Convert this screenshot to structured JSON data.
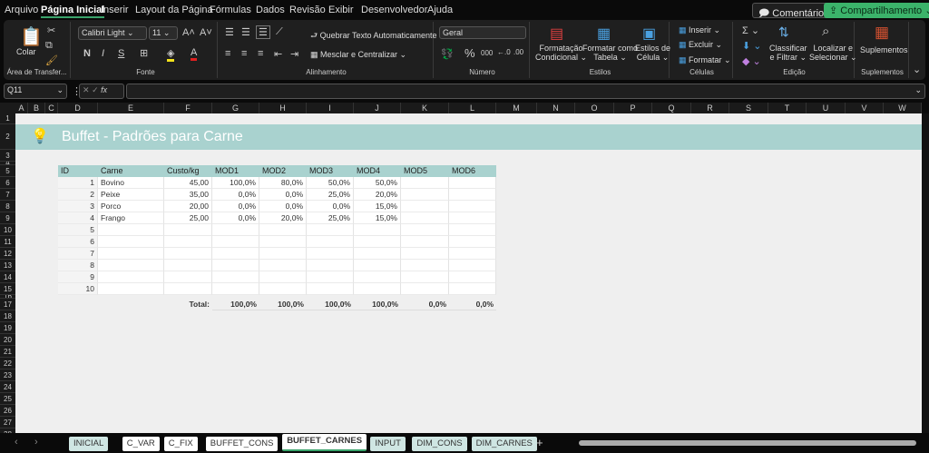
{
  "menu": [
    "Arquivo",
    "Página Inicial",
    "Inserir",
    "Layout da Página",
    "Fórmulas",
    "Dados",
    "Revisão",
    "Exibir",
    "Desenvolvedor",
    "Ajuda"
  ],
  "top_buttons": {
    "comments": "Comentários",
    "share": "Compartilhamento"
  },
  "colors": {
    "accent": "#3aa46b",
    "share": "#3bb36a",
    "table_header": "#a9d2cf"
  },
  "ribbon": {
    "clipboard": {
      "paste": "Colar",
      "label": "Área de Transfer..."
    },
    "font": {
      "name": "Calibri Light",
      "size": "11",
      "bold": "N",
      "italic": "I",
      "underline": "S",
      "label": "Fonte"
    },
    "alignment": {
      "wrap": "Quebrar Texto Automaticamente",
      "merge": "Mesclar e Centralizar",
      "label": "Alinhamento"
    },
    "number": {
      "format": "Geral",
      "label": "Número"
    },
    "styles": {
      "conditional": [
        "Formatação",
        "Condicional"
      ],
      "table": [
        "Formatar como",
        "Tabela"
      ],
      "cell": [
        "Estilos de",
        "Célula"
      ],
      "label": "Estilos"
    },
    "cells": {
      "insert": "Inserir",
      "delete": "Excluir",
      "format": "Formatar",
      "label": "Células"
    },
    "editing": {
      "sort": [
        "Classificar",
        "e Filtrar"
      ],
      "find": [
        "Localizar e",
        "Selecionar"
      ],
      "label": "Edição"
    },
    "addins": {
      "button": "Suplementos",
      "label": "Suplementos"
    }
  },
  "formula_bar": {
    "name_box": "Q11",
    "formula": ""
  },
  "columns": [
    "A",
    "B",
    "C",
    "D",
    "E",
    "F",
    "G",
    "H",
    "I",
    "J",
    "K",
    "L",
    "M",
    "N",
    "O",
    "P",
    "Q",
    "R",
    "S",
    "T",
    "U",
    "V",
    "W"
  ],
  "rows": [
    "1",
    "2",
    "3",
    "4",
    "5",
    "6",
    "7",
    "8",
    "9",
    "10",
    "11",
    "12",
    "13",
    "14",
    "15",
    "16",
    "17",
    "18",
    "19",
    "20",
    "21",
    "22",
    "23",
    "24",
    "25",
    "26",
    "27",
    "28"
  ],
  "sheet": {
    "title": "Buffet - Padrões para Carne",
    "headers": [
      "ID",
      "Carne",
      "Custo/kg",
      "MOD1",
      "MOD2",
      "MOD3",
      "MOD4",
      "MOD5",
      "MOD6"
    ],
    "data": [
      [
        "1",
        "Bovino",
        "45,00",
        "100,0%",
        "80,0%",
        "50,0%",
        "50,0%",
        "",
        ""
      ],
      [
        "2",
        "Peixe",
        "35,00",
        "0,0%",
        "0,0%",
        "25,0%",
        "20,0%",
        "",
        ""
      ],
      [
        "3",
        "Porco",
        "20,00",
        "0,0%",
        "0,0%",
        "0,0%",
        "15,0%",
        "",
        ""
      ],
      [
        "4",
        "Frango",
        "25,00",
        "0,0%",
        "20,0%",
        "25,0%",
        "15,0%",
        "",
        ""
      ],
      [
        "5",
        "",
        "",
        "",
        "",
        "",
        "",
        "",
        ""
      ],
      [
        "6",
        "",
        "",
        "",
        "",
        "",
        "",
        "",
        ""
      ],
      [
        "7",
        "",
        "",
        "",
        "",
        "",
        "",
        "",
        ""
      ],
      [
        "8",
        "",
        "",
        "",
        "",
        "",
        "",
        "",
        ""
      ],
      [
        "9",
        "",
        "",
        "",
        "",
        "",
        "",
        "",
        ""
      ],
      [
        "10",
        "",
        "",
        "",
        "",
        "",
        "",
        "",
        ""
      ]
    ],
    "total_label": "Total:",
    "totals": [
      "100,0%",
      "100,0%",
      "100,0%",
      "100,0%",
      "0,0%",
      "0,0%"
    ]
  },
  "tabs": [
    {
      "name": "INICIAL",
      "color": "#cfe6e3"
    },
    {
      "name": "C_VAR",
      "color": "#ffffff"
    },
    {
      "name": "C_FIX",
      "color": "#ffffff"
    },
    {
      "name": "BUFFET_CONS",
      "color": "#ffffff"
    },
    {
      "name": "BUFFET_CARNES",
      "color": "#ffffff",
      "active": true
    },
    {
      "name": "INPUT",
      "color": "#cfe6e3"
    },
    {
      "name": "DIM_CONS",
      "color": "#cfe6e3"
    },
    {
      "name": "DIM_CARNES",
      "color": "#cfe6e3"
    }
  ]
}
